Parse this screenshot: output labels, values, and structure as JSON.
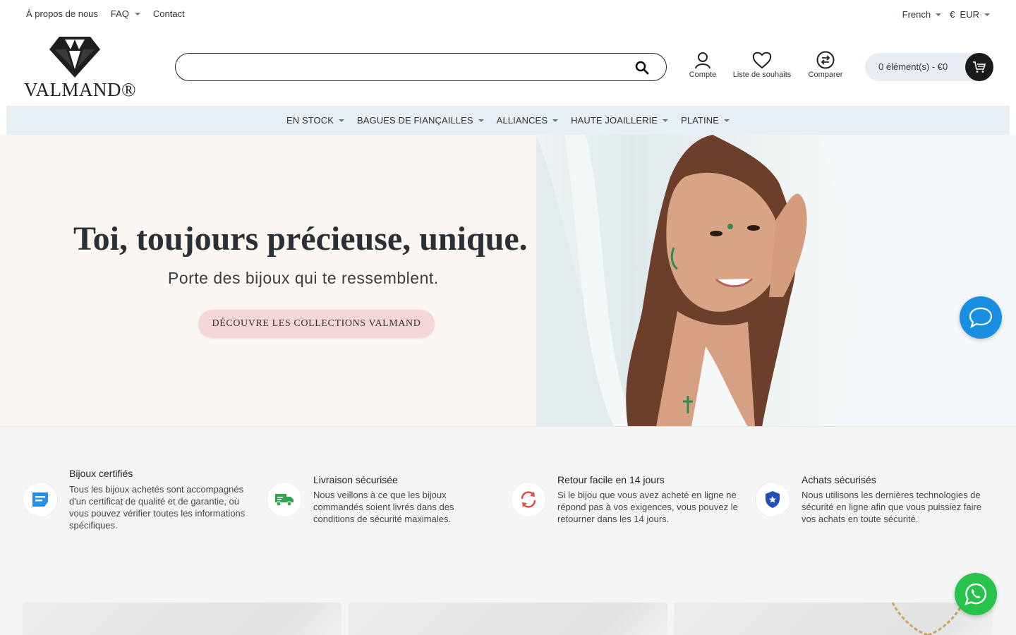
{
  "topbar": {
    "about": "À propos de nous",
    "faq": "FAQ",
    "contact": "Contact",
    "language": "French",
    "currency": "€  EUR"
  },
  "logo": {
    "wordmark": "VALMAND®"
  },
  "search": {
    "value": "",
    "placeholder": ""
  },
  "header": {
    "account": "Compte",
    "wishlist": "Liste de souhaits",
    "compare": "Comparer",
    "cart": "0 élément(s) - €0"
  },
  "nav": {
    "items": [
      {
        "label": "EN STOCK"
      },
      {
        "label": "BAGUES DE FIANÇAILLES"
      },
      {
        "label": "ALLIANCES"
      },
      {
        "label": "HAUTE JOAILLERIE"
      },
      {
        "label": "PLATINE"
      }
    ]
  },
  "hero": {
    "title": "Toi, toujours précieuse, unique.",
    "subtitle": "Porte des bijoux qui te ressemblent.",
    "cta": "DÉCOUVRE LES COLLECTIONS VALMAND"
  },
  "features": [
    {
      "title": "Bijoux certifiés",
      "desc": "Tous les bijoux achetés sont accompagnés d'un certificat de qualité et de garantie, où vous pouvez vérifier toutes les informations spécifiques.",
      "icon": "certificate-icon"
    },
    {
      "title": "Livraison sécurisée",
      "desc": "Nous veillons à ce que les bijoux commandés soient livrés dans des conditions de sécurité maximales.",
      "icon": "truck-icon"
    },
    {
      "title": "Retour facile en 14 jours",
      "desc": "Si le bijou que vous avez acheté en ligne ne répond pas à vos exigences, vous pouvez le retourner dans les 14 jours.",
      "icon": "return-icon"
    },
    {
      "title": "Achats sécurisés",
      "desc": "Nous utilisons les dernières technologies de sécurité en ligne afin que vous puissiez faire vos achats en toute sécurité.",
      "icon": "shield-star-icon"
    }
  ],
  "colors": {
    "nav_bg": "#e7eef4",
    "cta_bg": "#f4d6d6",
    "chat": "#1a8ee0",
    "whatsapp": "#27c24c",
    "feature_blue": "#2a8fe0",
    "feature_green": "#2ea44f",
    "feature_red": "#e04b4b",
    "feature_navy": "#1f4fb5"
  }
}
